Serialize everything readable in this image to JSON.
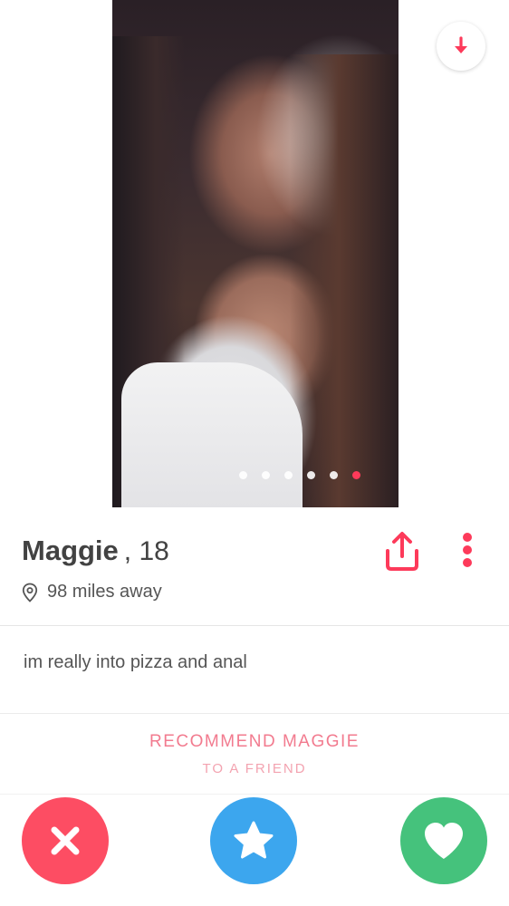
{
  "profile": {
    "name": "Maggie",
    "age": "18",
    "distance": "98 miles away",
    "bio": "im really into pizza and anal"
  },
  "photos": {
    "count": 6,
    "active_index": 5
  },
  "recommend": {
    "title": "RECOMMEND MAGGIE",
    "subtitle": "TO A FRIEND"
  },
  "icons": {
    "collapse": "arrow-down-icon",
    "share": "share-icon",
    "more": "more-vertical-icon",
    "location": "location-pin-icon",
    "nope": "close-icon",
    "super_like": "star-icon",
    "like": "heart-icon"
  },
  "colors": {
    "accent": "#fd3a5a",
    "nope": "#fd4d63",
    "super_like": "#3ca6ee",
    "like": "#45c27c",
    "recommend_text": "#f27b8f"
  }
}
